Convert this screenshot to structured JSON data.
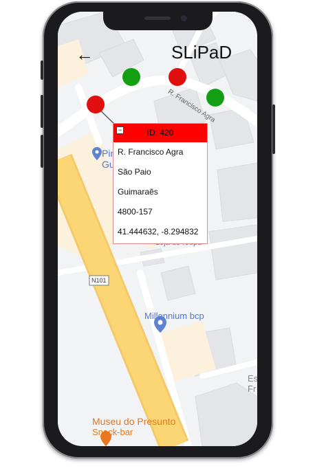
{
  "app": {
    "title": "SLiPaD",
    "back_symbol": "←"
  },
  "popup": {
    "header": "ID: 420",
    "close_symbol": "−",
    "rows": [
      "R. Francisco Agra",
      "São Paio",
      "Guimaraẽs",
      "4800-157",
      "41.444632, -8.294832"
    ]
  },
  "map_labels": {
    "street": "R. Francisco Agra",
    "shop_partial": "Pin",
    "shop_partial2": "Gu",
    "shop_clothes": "Loja de roupa",
    "road": "N101",
    "bank": "Millennium bcp",
    "museum": "Museu do Presunto",
    "museum_sub": "Snack-bar",
    "edge_partial": "Es",
    "edge_partial2": "Fr"
  },
  "markers": [
    {
      "color": "green",
      "status": "active"
    },
    {
      "color": "red",
      "status": "alert"
    },
    {
      "color": "green",
      "status": "active"
    },
    {
      "color": "red",
      "status": "alert"
    }
  ],
  "colors": {
    "accent_red": "#ff0000",
    "marker_red": "#e01010",
    "marker_green": "#12a012",
    "highway": "#fcd675"
  }
}
